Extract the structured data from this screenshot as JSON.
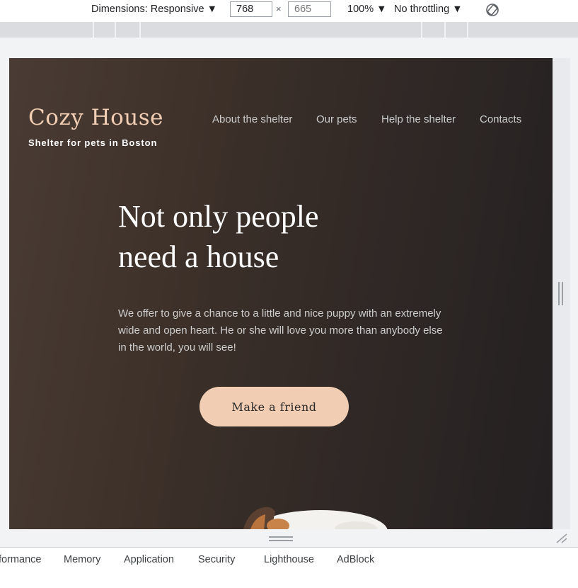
{
  "devtools": {
    "toolbar": {
      "dimensions_label": "Dimensions: Responsive ▼",
      "width_value": "768",
      "height_placeholder": "665",
      "times": "×",
      "zoom_label": "100% ▼",
      "throttling_label": "No throttling ▼"
    },
    "tabs": [
      "formance",
      "Memory",
      "Application",
      "Security",
      "Lighthouse",
      "AdBlock"
    ]
  },
  "page": {
    "logo": "Cozy House",
    "subtitle": "Shelter for pets in Boston",
    "nav": [
      "About the shelter",
      "Our pets",
      "Help the shelter",
      "Contacts"
    ],
    "hero": {
      "title_line1": "Not only people",
      "title_line2": "need a house",
      "text": "We offer to give a chance to a little and nice puppy with an extremely wide and open heart. He or she will love you more than anybody else in the world, you will see!",
      "cta_label": "Make a friend"
    },
    "colors": {
      "accent": "#f1cdb3",
      "background_dark": "#292929",
      "text_light": "#cdcdcd"
    }
  }
}
